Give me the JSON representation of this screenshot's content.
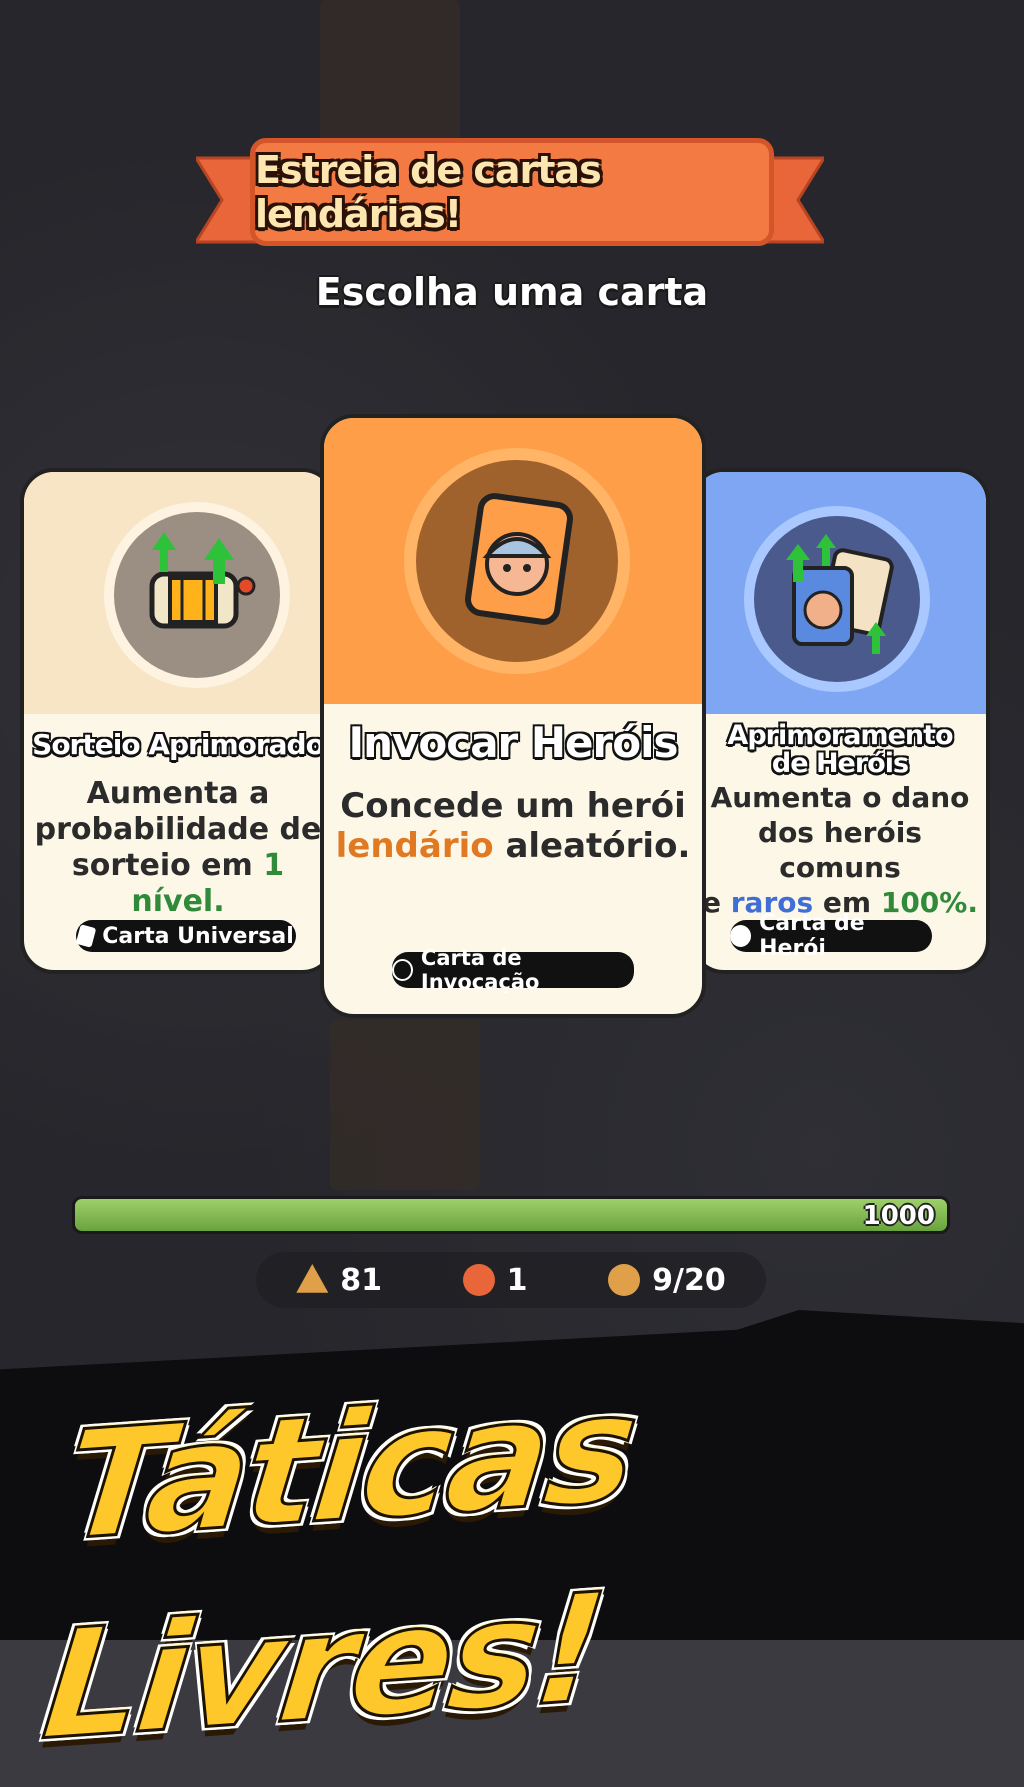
{
  "banner": {
    "title": "Estreia de cartas lendárias!",
    "subtitle": "Escolha uma carta"
  },
  "cards": [
    {
      "title": "Sorteio Aprimorado",
      "desc_line1": "Aumenta a",
      "desc_line2": "probabilidade de",
      "desc_line3a": "sorteio em ",
      "desc_line3b": "1 nível.",
      "tag": "Carta Universal",
      "icon": "slot-machine-icon"
    },
    {
      "title": "Invocar Heróis",
      "desc_line1": "Concede um herói",
      "desc_line2a": "lendário",
      "desc_line2b": " aleatório.",
      "tag": "Carta de Invocação",
      "icon": "hero-card-icon"
    },
    {
      "title_line1": "Aprimoramento",
      "title_line2": "de Heróis",
      "desc_line1": "Aumenta o dano",
      "desc_line2": "dos heróis comuns",
      "desc_line3a": "e ",
      "desc_line3b": "raros",
      "desc_line3c": " em ",
      "desc_line3d": "100%.",
      "tag": "Carta de Herói",
      "icon": "hero-upgrade-icon"
    }
  ],
  "progress": {
    "label": "1000",
    "fill_fraction": 1.0
  },
  "resources": {
    "gems": "81",
    "tickets": "1",
    "heroes": "9/20"
  },
  "promo": {
    "text": "Táticas Livres!"
  },
  "colors": {
    "orange": "#e07a22",
    "green": "#2f8a3a",
    "blue": "#3f6fd6",
    "banner": "#f47a44"
  }
}
